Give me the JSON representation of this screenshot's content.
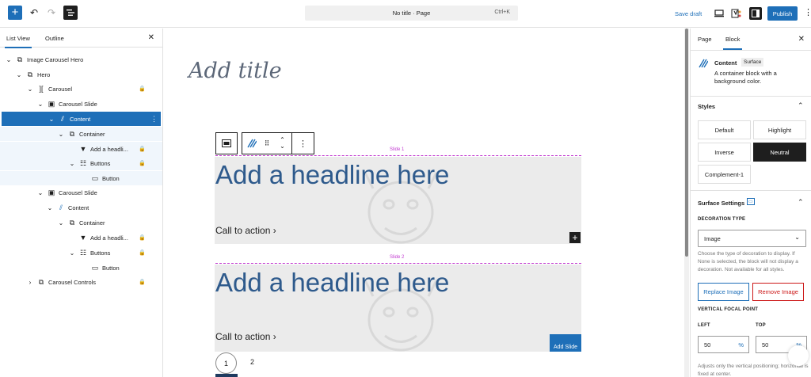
{
  "topbar": {
    "doc_title": "No title · Page",
    "shortcut": "Ctrl+K",
    "save_draft": "Save draft",
    "publish": "Publish",
    "add_icon": "plus-icon",
    "undo_icon": "undo-icon",
    "redo_icon": "redo-icon"
  },
  "left_panel": {
    "tabs": [
      "List View",
      "Outline"
    ],
    "items": [
      {
        "label": "Image Carousel Hero",
        "icon": "group-icon"
      },
      {
        "label": "Hero",
        "icon": "group-icon"
      },
      {
        "label": "Carousel",
        "icon": "carousel-icon"
      },
      {
        "label": "Carousel Slide",
        "icon": "slide-icon"
      },
      {
        "label": "Content",
        "icon": "content-icon"
      },
      {
        "label": "Container",
        "icon": "group-icon"
      },
      {
        "label": "Add a headli...",
        "icon": "bookmark-icon"
      },
      {
        "label": "Buttons",
        "icon": "buttons-icon"
      },
      {
        "label": "Button",
        "icon": "button-icon"
      },
      {
        "label": "Carousel Slide",
        "icon": "slide-icon"
      },
      {
        "label": "Content",
        "icon": "content-icon"
      },
      {
        "label": "Container",
        "icon": "group-icon"
      },
      {
        "label": "Add a headli...",
        "icon": "bookmark-icon"
      },
      {
        "label": "Buttons",
        "icon": "buttons-icon"
      },
      {
        "label": "Button",
        "icon": "button-icon"
      },
      {
        "label": "Carousel Controls",
        "icon": "group-icon"
      }
    ]
  },
  "canvas": {
    "page_title_placeholder": "Add title",
    "slide1_label": "Slide 1",
    "slide2_label": "Slide 2",
    "headline": "Add a headline here",
    "cta": "Call to action",
    "add_slide": "Add Slide",
    "pager": [
      "1",
      "2"
    ]
  },
  "right_panel": {
    "tabs": [
      "Page",
      "Block"
    ],
    "block_name": "Content",
    "block_badge": "Surface",
    "block_desc": "A container block with a background color.",
    "styles_title": "Styles",
    "styles": [
      "Default",
      "Highlight",
      "Inverse",
      "Neutral",
      "Complement-1"
    ],
    "surface_settings": "Surface Settings",
    "decoration_type_label": "DECORATION TYPE",
    "decoration_value": "Image",
    "decoration_help": "Choose the type of decoration to display. If None is selected, the block will not display a decoration. Not available for all styles.",
    "replace_image": "Replace Image",
    "remove_image": "Remove Image",
    "focal_label": "VERTICAL FOCAL POINT",
    "left_label": "LEFT",
    "top_label": "TOP",
    "left_value": "50",
    "top_value": "50",
    "unit": "%",
    "focal_help": "Adjusts only the vertical positioning; horizontal is fixed at center."
  }
}
